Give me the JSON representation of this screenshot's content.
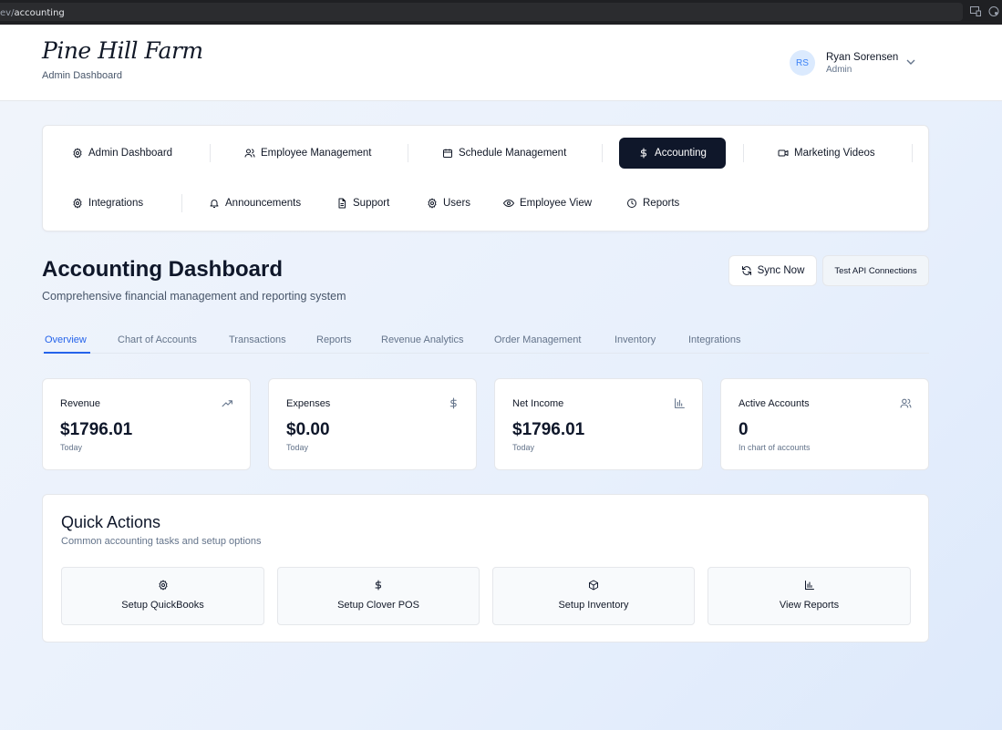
{
  "browser": {
    "url_prefix": "ev/",
    "url_path": "accounting"
  },
  "header": {
    "logo": "Pine Hill Farm",
    "subtitle": "Admin Dashboard",
    "user": {
      "initials": "RS",
      "name": "Ryan Sorensen",
      "role": "Admin"
    }
  },
  "nav": {
    "items": [
      {
        "label": "Admin Dashboard",
        "icon": "gear-icon"
      },
      {
        "label": "Employee Management",
        "icon": "users-icon"
      },
      {
        "label": "Schedule Management",
        "icon": "calendar-icon"
      },
      {
        "label": "Accounting",
        "icon": "dollar-icon",
        "active": true
      },
      {
        "label": "Marketing Videos",
        "icon": "video-icon"
      },
      {
        "label": "Integrations",
        "icon": "gear-icon"
      },
      {
        "label": "Announcements",
        "icon": "bell-icon"
      },
      {
        "label": "Support",
        "icon": "document-icon"
      },
      {
        "label": "Users",
        "icon": "gear-icon"
      },
      {
        "label": "Employee View",
        "icon": "eye-icon"
      },
      {
        "label": "Reports",
        "icon": "clock-icon"
      }
    ]
  },
  "page": {
    "title": "Accounting Dashboard",
    "description": "Comprehensive financial management and reporting system",
    "sync_label": "Sync Now",
    "test_api_label": "Test API Connections"
  },
  "tabs": [
    {
      "label": "Overview",
      "active": true
    },
    {
      "label": "Chart of Accounts"
    },
    {
      "label": "Transactions"
    },
    {
      "label": "Reports"
    },
    {
      "label": "Revenue Analytics"
    },
    {
      "label": "Order Management"
    },
    {
      "label": "Inventory"
    },
    {
      "label": "Integrations"
    }
  ],
  "stats": [
    {
      "label": "Revenue",
      "value": "$1796.01",
      "sub": "Today",
      "icon": "trending-up-icon"
    },
    {
      "label": "Expenses",
      "value": "$0.00",
      "sub": "Today",
      "icon": "dollar-icon"
    },
    {
      "label": "Net Income",
      "value": "$1796.01",
      "sub": "Today",
      "icon": "bar-chart-icon"
    },
    {
      "label": "Active Accounts",
      "value": "0",
      "sub": "In chart of accounts",
      "icon": "users-icon"
    }
  ],
  "quick_actions": {
    "title": "Quick Actions",
    "description": "Common accounting tasks and setup options",
    "items": [
      {
        "label": "Setup QuickBooks",
        "icon": "gear-icon"
      },
      {
        "label": "Setup Clover POS",
        "icon": "dollar-icon"
      },
      {
        "label": "Setup Inventory",
        "icon": "package-icon"
      },
      {
        "label": "View Reports",
        "icon": "bar-chart-icon"
      }
    ]
  },
  "colors": {
    "primary_dark": "#0f172a",
    "accent_blue": "#2563eb",
    "avatar_bg": "#dbeafe"
  }
}
